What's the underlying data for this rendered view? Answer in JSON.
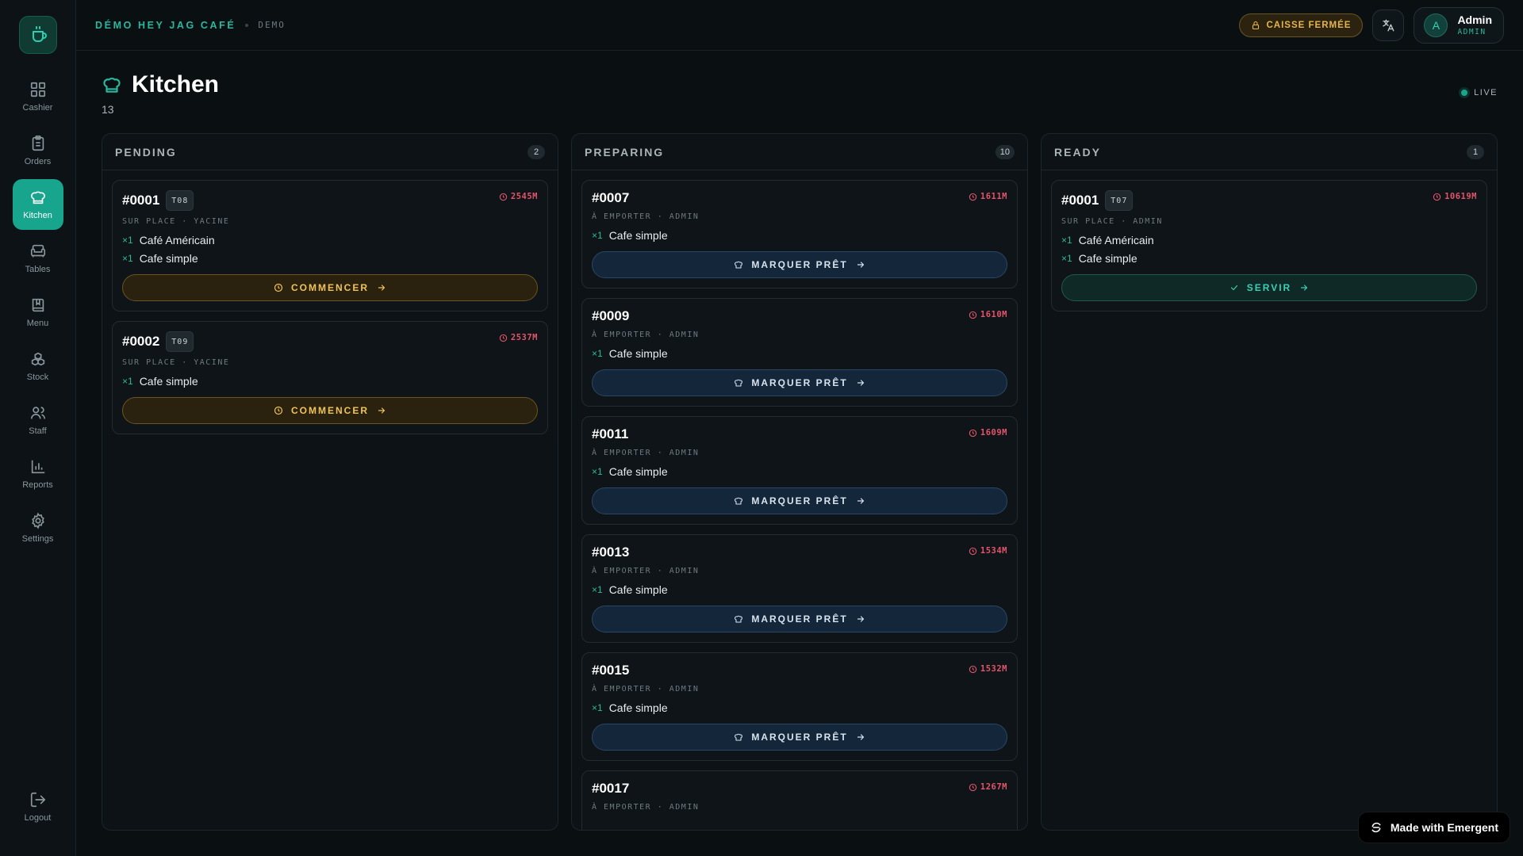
{
  "sidebar": {
    "items": [
      {
        "label": "Cashier",
        "icon": "grid-icon"
      },
      {
        "label": "Orders",
        "icon": "clipboard-icon"
      },
      {
        "label": "Kitchen",
        "icon": "chef-hat-icon",
        "active": true
      },
      {
        "label": "Tables",
        "icon": "armchair-icon"
      },
      {
        "label": "Menu",
        "icon": "book-icon"
      },
      {
        "label": "Stock",
        "icon": "boxes-icon"
      },
      {
        "label": "Staff",
        "icon": "users-icon"
      },
      {
        "label": "Reports",
        "icon": "bar-chart-icon"
      },
      {
        "label": "Settings",
        "icon": "gear-icon"
      }
    ],
    "logout": "Logout"
  },
  "header": {
    "brand": "DÉMO HEY JAG CAFÉ",
    "env": "DEMO",
    "register_status": "CAISSE FERMÉE",
    "user": {
      "initial": "A",
      "name": "Admin",
      "role": "ADMIN"
    }
  },
  "page": {
    "title": "Kitchen",
    "subtitle": "13",
    "live": "LIVE"
  },
  "columns": {
    "pending": {
      "title": "PENDING",
      "count": "2",
      "cards": [
        {
          "order": "#0001",
          "table": "T08",
          "timer": "2545M",
          "meta": "SUR PLACE · YACINE",
          "items": [
            {
              "qty": "×1",
              "name": "Café Américain"
            },
            {
              "qty": "×1",
              "name": "Cafe simple"
            }
          ],
          "action": "COMMENCER"
        },
        {
          "order": "#0002",
          "table": "T09",
          "timer": "2537M",
          "meta": "SUR PLACE · YACINE",
          "items": [
            {
              "qty": "×1",
              "name": "Cafe simple"
            }
          ],
          "action": "COMMENCER"
        }
      ]
    },
    "preparing": {
      "title": "PREPARING",
      "count": "10",
      "cards": [
        {
          "order": "#0007",
          "timer": "1611M",
          "meta": "À EMPORTER · ADMIN",
          "items": [
            {
              "qty": "×1",
              "name": "Cafe simple"
            }
          ],
          "action": "MARQUER PRÊT"
        },
        {
          "order": "#0009",
          "timer": "1610M",
          "meta": "À EMPORTER · ADMIN",
          "items": [
            {
              "qty": "×1",
              "name": "Cafe simple"
            }
          ],
          "action": "MARQUER PRÊT"
        },
        {
          "order": "#0011",
          "timer": "1609M",
          "meta": "À EMPORTER · ADMIN",
          "items": [
            {
              "qty": "×1",
              "name": "Cafe simple"
            }
          ],
          "action": "MARQUER PRÊT"
        },
        {
          "order": "#0013",
          "timer": "1534M",
          "meta": "À EMPORTER · ADMIN",
          "items": [
            {
              "qty": "×1",
              "name": "Cafe simple"
            }
          ],
          "action": "MARQUER PRÊT"
        },
        {
          "order": "#0015",
          "timer": "1532M",
          "meta": "À EMPORTER · ADMIN",
          "items": [
            {
              "qty": "×1",
              "name": "Cafe simple"
            }
          ],
          "action": "MARQUER PRÊT"
        },
        {
          "order": "#0017",
          "timer": "1267M",
          "meta": "À EMPORTER · ADMIN",
          "items": [],
          "action": ""
        }
      ]
    },
    "ready": {
      "title": "READY",
      "count": "1",
      "cards": [
        {
          "order": "#0001",
          "table": "T07",
          "timer": "10619M",
          "meta": "SUR PLACE · ADMIN",
          "items": [
            {
              "qty": "×1",
              "name": "Café Américain"
            },
            {
              "qty": "×1",
              "name": "Cafe simple"
            }
          ],
          "action": "SERVIR"
        }
      ]
    }
  },
  "badge": "Made with Emergent",
  "colors": {
    "accent": "#17a58e",
    "warning": "#e6b54a",
    "timer": "#e2546a"
  }
}
